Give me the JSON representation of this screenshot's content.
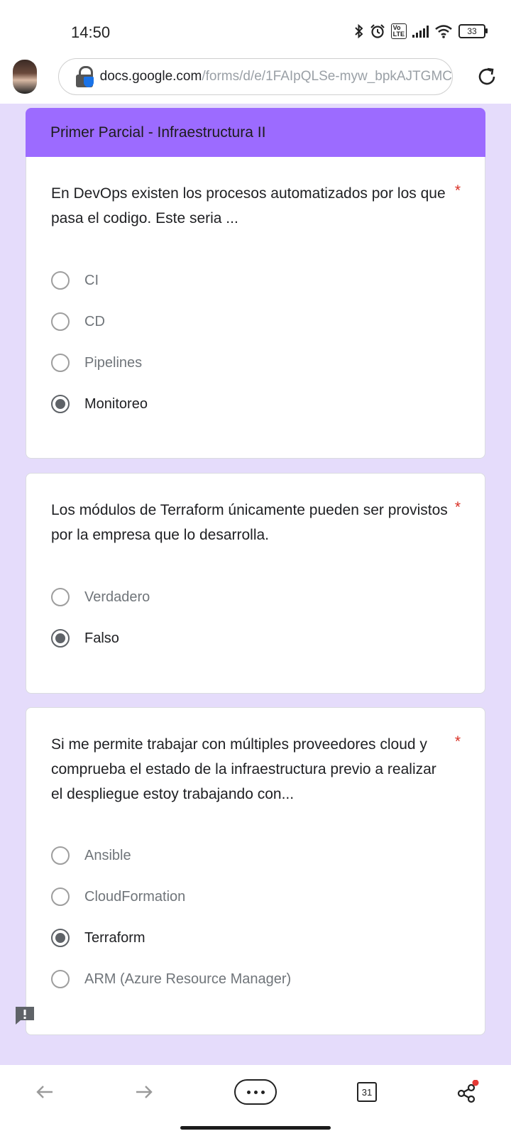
{
  "status_bar": {
    "time": "14:50",
    "battery": "33"
  },
  "browser": {
    "url_host": "docs.google.com",
    "url_path": "/forms/d/e/1FAIpQLSe-myw_bpkAJTGMC",
    "tab_count": "31"
  },
  "form": {
    "title": "Primer Parcial - Infraestructura II",
    "accent_color": "#9c6bff",
    "background_color": "#e5dcfb",
    "required_mark": "*",
    "questions": [
      {
        "text": "En DevOps existen los procesos automatizados por los que pasa el codigo. Este seria ...",
        "options": [
          "CI",
          "CD",
          "Pipelines",
          "Monitoreo"
        ],
        "selected": "Monitoreo"
      },
      {
        "text": "Los módulos de Terraform únicamente pueden ser provistos por la empresa que lo desarrolla.",
        "options": [
          "Verdadero",
          "Falso"
        ],
        "selected": "Falso"
      },
      {
        "text": "Si me permite trabajar con múltiples proveedores cloud y comprueba el estado de la infraestructura previo a realizar el despliegue estoy trabajando con...",
        "options": [
          "Ansible",
          "CloudFormation",
          "Terraform",
          "ARM (Azure Resource Manager)"
        ],
        "selected": "Terraform"
      }
    ]
  },
  "icons": [
    "bluetooth-icon",
    "alarm-icon",
    "volte-icon",
    "signal-icon",
    "wifi-icon",
    "battery-icon",
    "lock-icon",
    "reload-icon",
    "report-icon",
    "back-icon",
    "forward-icon",
    "more-icon",
    "tabs-icon",
    "share-icon"
  ]
}
